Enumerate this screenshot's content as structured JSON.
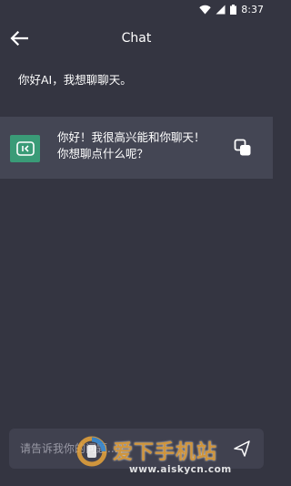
{
  "status_bar": {
    "time": "8:37",
    "icons": [
      "wifi-icon",
      "signal-icon",
      "battery-icon"
    ]
  },
  "header": {
    "title": "Chat",
    "back_icon": "back-arrow-icon"
  },
  "messages": {
    "user": "你好AI，我想聊聊天。",
    "ai_line1": "你好！我很高兴能和你聊天！",
    "ai_line2": "你想聊点什么呢？",
    "ai_avatar_icon": "ai-avatar-icon",
    "copy_icon": "copy-icon"
  },
  "input": {
    "placeholder": "请告诉我你的问题..."
  },
  "watermark": {
    "brand": "爱下手机站",
    "url": "www.aiskycn.com"
  },
  "colors": {
    "background": "#343541",
    "ai_row": "#444654",
    "avatar": "#3a9b77",
    "input_bg": "#40414f",
    "watermark_orange": "#e9a43a"
  }
}
